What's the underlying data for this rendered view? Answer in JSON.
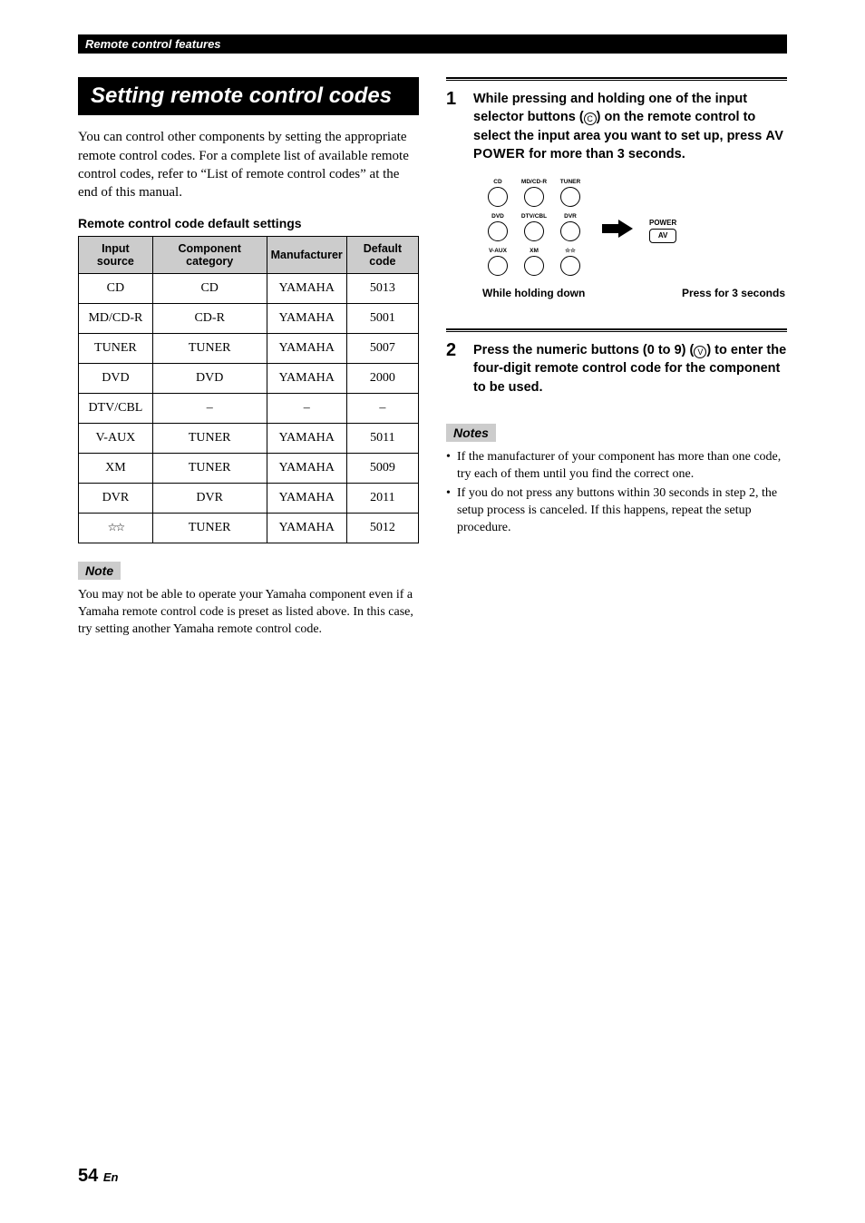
{
  "header": {
    "breadcrumb": "Remote control features"
  },
  "left": {
    "section_title": "Setting remote control codes",
    "intro": "You can control other components by setting the appropriate remote control codes. For a complete list of available remote control codes, refer to “List of remote control codes” at the end of this manual.",
    "table_title": "Remote control code default settings",
    "table": {
      "headers": [
        "Input source",
        "Component category",
        "Manufacturer",
        "Default code"
      ],
      "rows": [
        [
          "CD",
          "CD",
          "YAMAHA",
          "5013"
        ],
        [
          "MD/CD-R",
          "CD-R",
          "YAMAHA",
          "5001"
        ],
        [
          "TUNER",
          "TUNER",
          "YAMAHA",
          "5007"
        ],
        [
          "DVD",
          "DVD",
          "YAMAHA",
          "2000"
        ],
        [
          "DTV/CBL",
          "–",
          "–",
          "–"
        ],
        [
          "V-AUX",
          "TUNER",
          "YAMAHA",
          "5011"
        ],
        [
          "XM",
          "TUNER",
          "YAMAHA",
          "5009"
        ],
        [
          "DVR",
          "DVR",
          "YAMAHA",
          "2011"
        ],
        [
          "☆☆",
          "TUNER",
          "YAMAHA",
          "5012"
        ]
      ]
    },
    "note_label": "Note",
    "note_text": "You may not be able to operate your Yamaha component even if a Yamaha remote control code is preset as listed above. In this case, try setting another Yamaha remote control code."
  },
  "right": {
    "steps": [
      {
        "num": "1",
        "pre": "While pressing and holding one of the input selector buttons (",
        "circ": "C",
        "mid": ") on the remote control to select the input area you want to set up, press ",
        "av": "AV POWER",
        "post": " for more than 3 seconds."
      },
      {
        "num": "2",
        "pre": "Press the numeric buttons (0 to 9) (",
        "circ": "V",
        "mid": ") to enter the four-digit remote control code for the component to be used.",
        "av": "",
        "post": ""
      }
    ],
    "diagram": {
      "selectors": [
        [
          "CD",
          "MD/CD-R",
          "TUNER"
        ],
        [
          "DVD",
          "DTV/CBL",
          "DVR"
        ],
        [
          "V-AUX",
          "XM",
          "☆☆"
        ]
      ],
      "power_label": "POWER",
      "av_label": "AV",
      "caption_left": "While holding down",
      "caption_right": "Press for 3 seconds"
    },
    "notes_label": "Notes",
    "notes": [
      "If the manufacturer of your component has more than one code, try each of them until you find the correct one.",
      "If you do not press any buttons within 30 seconds in step 2, the setup process is canceled. If this happens, repeat the setup procedure."
    ]
  },
  "footer": {
    "page": "54",
    "suffix": "En"
  }
}
